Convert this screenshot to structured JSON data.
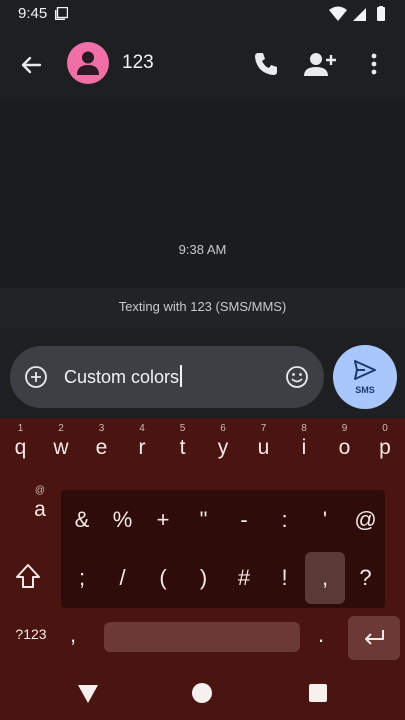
{
  "status_bar": {
    "time": "9:45",
    "icons": [
      "notification-icon",
      "wifi-icon",
      "signal-icon",
      "battery-icon"
    ]
  },
  "header": {
    "contact_name": "123",
    "avatar_color": "#f06fa6",
    "actions": [
      "back-arrow-icon",
      "phone-icon",
      "add-contact-icon",
      "more-vert-icon"
    ]
  },
  "conversation": {
    "timestamp": "9:38 AM",
    "info_text": "Texting with 123 (SMS/MMS)"
  },
  "compose": {
    "value": "Custom colors",
    "send_label": "SMS",
    "send_color": "#a8c7fa"
  },
  "keyboard": {
    "theme_color": "#4a1410",
    "row1": [
      {
        "key": "q",
        "hint": "1"
      },
      {
        "key": "w",
        "hint": "2"
      },
      {
        "key": "e",
        "hint": "3"
      },
      {
        "key": "r",
        "hint": "4"
      },
      {
        "key": "t",
        "hint": "5"
      },
      {
        "key": "y",
        "hint": "6"
      },
      {
        "key": "u",
        "hint": "7"
      },
      {
        "key": "i",
        "hint": "8"
      },
      {
        "key": "o",
        "hint": "9"
      },
      {
        "key": "p",
        "hint": "0"
      }
    ],
    "row2_visible": {
      "key": "a",
      "hint": "@"
    },
    "popup_row1": [
      "&",
      "%",
      "+",
      "\"",
      "-",
      ":",
      "'",
      "@"
    ],
    "popup_row2": [
      ";",
      "/",
      "(",
      ")",
      "#",
      "!",
      ",",
      "?"
    ],
    "symbols_label": "?123",
    "comma": ",",
    "period": "."
  }
}
